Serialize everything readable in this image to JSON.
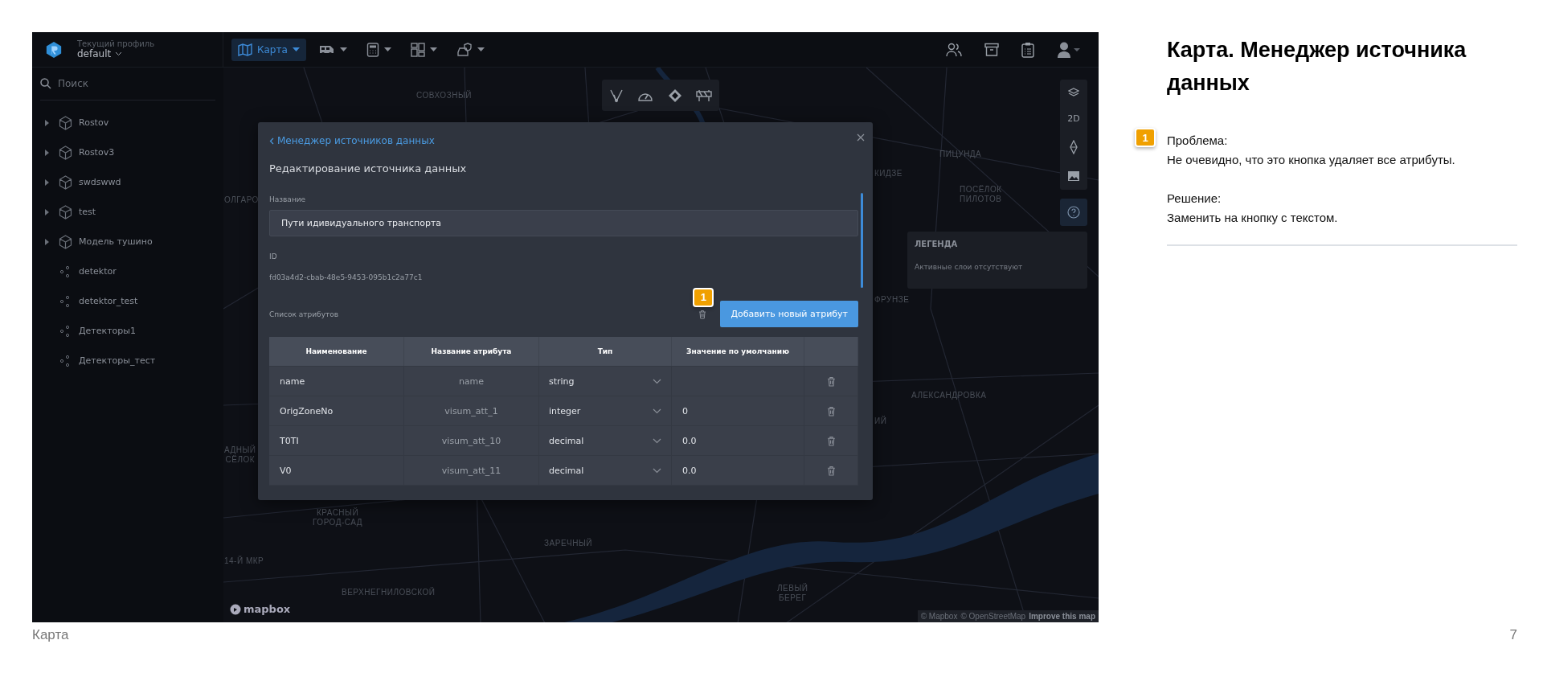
{
  "app": {
    "profile": {
      "label": "Текущий профиль",
      "value": "default"
    },
    "nav": [
      {
        "kind": "map",
        "label": "Карта",
        "selected": true
      },
      {
        "kind": "bus",
        "selected": false
      },
      {
        "kind": "calculator",
        "selected": false
      },
      {
        "kind": "dashboard",
        "selected": false
      },
      {
        "kind": "car-shield",
        "selected": false
      }
    ],
    "sidebar": {
      "search_placeholder": "Поиск",
      "items": [
        {
          "kind": "model",
          "label": "Rostov"
        },
        {
          "kind": "model",
          "label": "Rostov3"
        },
        {
          "kind": "model",
          "label": "swdswwd"
        },
        {
          "kind": "model",
          "label": "test"
        },
        {
          "kind": "model",
          "label": "Модель тушино"
        },
        {
          "kind": "detector",
          "label": "detektor"
        },
        {
          "kind": "detector",
          "label": "detektor_test"
        },
        {
          "kind": "detector",
          "label": "Детекторы1"
        },
        {
          "kind": "detector",
          "label": "Детекторы_тест"
        }
      ]
    },
    "map": {
      "labels": [
        "СОВХОЗНЫЙ",
        "ОЛГАРО",
        "ПИЦУНДА",
        "КИДЗЕ",
        "ПОСЁЛОК\nПИЛОТОВ",
        "ФРУНЗЕ",
        "АЛЕКСАНДРОВКА",
        "ИЙ",
        "АДНЫЙ\nСЁЛОК",
        "КРАСНЫЙ\nГОРОД-САД",
        "ЗАРЕЧНЫЙ",
        "14-Й МКР",
        "ВЕРХНЕГНИЛОВСКОЙ",
        "ЛЕВЫЙ\nБЕРЕГ"
      ],
      "view_mode": "2D",
      "legend": {
        "title": "ЛЕГЕНДА",
        "text": "Активные слои отсутствуют"
      },
      "logo": "mapbox",
      "attribution": [
        "© Mapbox",
        "© OpenStreetMap",
        "Improve this map"
      ]
    },
    "modal": {
      "back_link": "Менеджер источников данных",
      "title": "Редактирование источника данных",
      "name_field": {
        "label": "Название",
        "value": "Пути идивидуального транспорта"
      },
      "id_field": {
        "label": "ID",
        "value": "fd03a4d2-cbab-48e5-9453-095b1c2a77c1"
      },
      "attributes_label": "Список атрибутов",
      "marker": "1",
      "add_button": "Добавить новый атрибут",
      "columns": [
        "Наименование",
        "Название атрибута",
        "Тип",
        "Значение по умолчанию"
      ],
      "rows": [
        {
          "name": "name",
          "attribute": "name",
          "type": "string"
        },
        {
          "name": "OrigZoneNo",
          "attribute": "visum_att_1",
          "type": "integer",
          "default": "0"
        },
        {
          "name": "T0TI",
          "attribute": "visum_att_10",
          "type": "decimal",
          "default": "0.0"
        },
        {
          "name": "V0",
          "attribute": "visum_att_11",
          "type": "decimal",
          "default": "0.0"
        }
      ]
    }
  },
  "slide": {
    "title": "Карта. Менеджер источника данных",
    "notes": [
      {
        "marker": "1",
        "problem_label": "Проблема:",
        "problem": "Не очевидно, что это кнопка удаляет все атрибуты.",
        "solution_label": "Решение:",
        "solution": "Заменить на кнопку с текстом."
      }
    ],
    "footer": "Карта",
    "page": "7"
  }
}
